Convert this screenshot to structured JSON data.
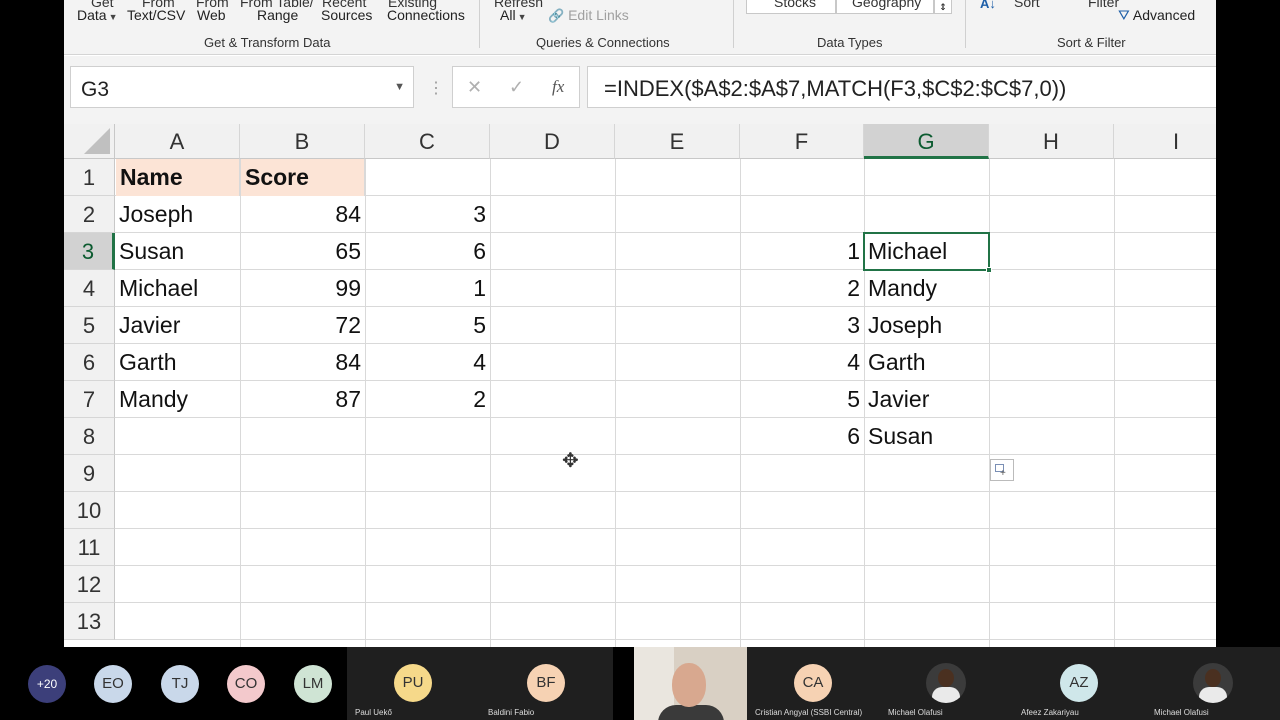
{
  "ribbon": {
    "top_labels": [
      "Get",
      "From",
      "From",
      "From Table/",
      "Recent",
      "Existing",
      "Refresh",
      "Stocks",
      "Geography",
      "Sort",
      "Filter"
    ],
    "buttons": {
      "get_data": "Data",
      "from_text": "Text/CSV",
      "from_web": "Web",
      "from_range": "Range",
      "recent_sources": "Sources",
      "existing_connections": "Connections",
      "refresh_all": "All",
      "edit_links": "Edit Links",
      "advanced": "Advanced"
    },
    "groups": {
      "get_transform": "Get & Transform Data",
      "queries": "Queries & Connections",
      "data_types": "Data Types",
      "sort_filter": "Sort & Filter"
    }
  },
  "formula_bar": {
    "name_box": "G3",
    "cancel": "✕",
    "enter": "✓",
    "fx": "fx",
    "formula": "=INDEX($A$2:$A$7,MATCH(F3,$C$2:$C$7,0))"
  },
  "sheet": {
    "columns": [
      "A",
      "B",
      "C",
      "D",
      "E",
      "F",
      "G",
      "H",
      "I"
    ],
    "rows": [
      "1",
      "2",
      "3",
      "4",
      "5",
      "6",
      "7",
      "8",
      "9",
      "10",
      "11",
      "12",
      "13"
    ],
    "selected_cell": "G3",
    "headers": {
      "a1": "Name",
      "b1": "Score"
    },
    "table": [
      {
        "name": "Joseph",
        "score": "84",
        "rank": "3"
      },
      {
        "name": "Susan",
        "score": "65",
        "rank": "6"
      },
      {
        "name": "Michael",
        "score": "99",
        "rank": "1"
      },
      {
        "name": "Javier",
        "score": "72",
        "rank": "5"
      },
      {
        "name": "Garth",
        "score": "84",
        "rank": "4"
      },
      {
        "name": "Mandy",
        "score": "87",
        "rank": "2"
      }
    ],
    "lookup": [
      {
        "rank": "1",
        "name": "Michael"
      },
      {
        "rank": "2",
        "name": "Mandy"
      },
      {
        "rank": "3",
        "name": "Joseph"
      },
      {
        "rank": "4",
        "name": "Garth"
      },
      {
        "rank": "5",
        "name": "Javier"
      },
      {
        "rank": "6",
        "name": "Susan"
      }
    ]
  },
  "participants": {
    "more_count": "+20",
    "avatars": [
      {
        "initials": "EO",
        "color": "#c9d8ea"
      },
      {
        "initials": "TJ",
        "color": "#c9d8ea"
      },
      {
        "initials": "CO",
        "color": "#f3c9cc"
      },
      {
        "initials": "LM",
        "color": "#cfe4d4"
      }
    ],
    "tiles": [
      {
        "initials": "PU",
        "name": "Paul Uekő",
        "color": "#f6d98a"
      },
      {
        "initials": "BF",
        "name": "Baldini Fabio",
        "color": "#f6d2b3"
      },
      {
        "initials": "CA",
        "name": "Cristian Angyal (SSBI Central)",
        "color": "#f6d2b3"
      },
      {
        "initials": "",
        "name": "Michael Olafusi",
        "color": ""
      },
      {
        "initials": "AZ",
        "name": "Afeez Zakariyau",
        "color": "#cfe7ea"
      },
      {
        "initials": "",
        "name": "Michael Olafusi",
        "color": ""
      }
    ]
  }
}
